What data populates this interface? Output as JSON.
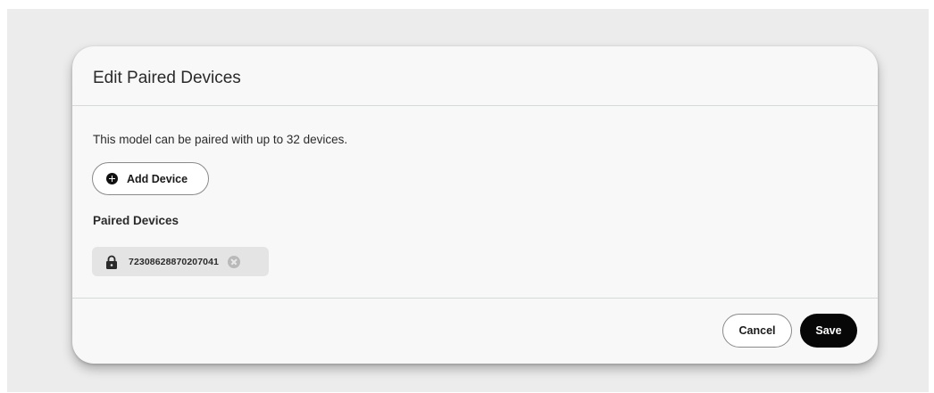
{
  "dialog": {
    "title": "Edit Paired Devices",
    "description": "This model can be paired with up to 32 devices.",
    "add_device_label": "Add Device",
    "paired_devices_label": "Paired Devices",
    "paired_devices": [
      {
        "id": "723086288702070­41",
        "icon": "lock-icon"
      }
    ],
    "cancel_label": "Cancel",
    "save_label": "Save"
  },
  "colors": {
    "backdrop": "#ececec",
    "dialog_bg": "#f7f8f7",
    "chip_bg": "#e3e4e3",
    "primary_button": "#070707"
  }
}
